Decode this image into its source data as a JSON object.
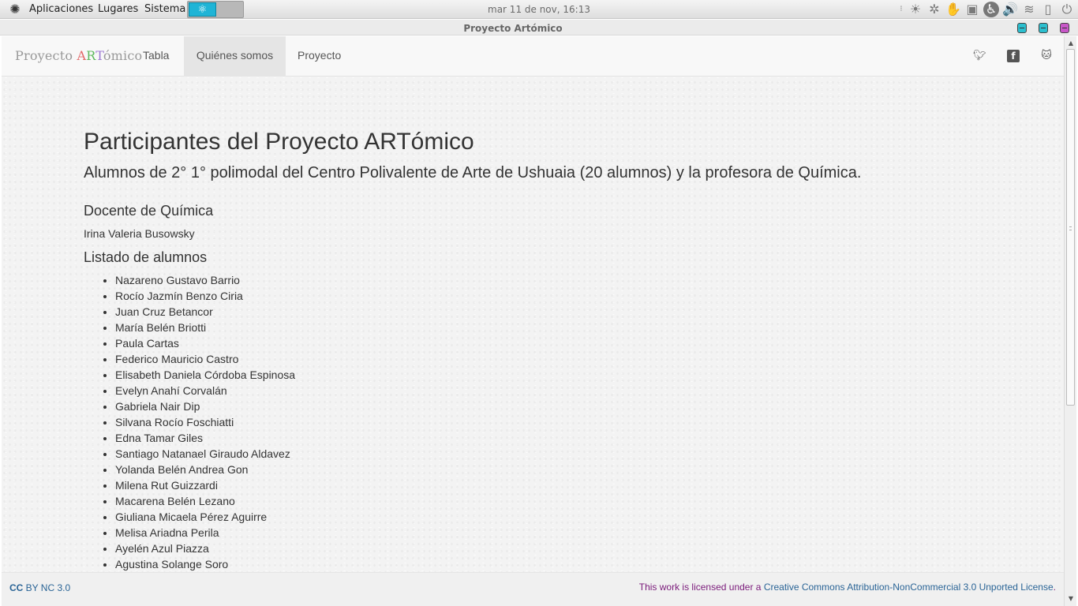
{
  "panel": {
    "menus": [
      "Aplicaciones",
      "Lugares",
      "Sistema"
    ],
    "clock": "mar 11 de nov, 16:13",
    "tray_icons": [
      "brightness-icon",
      "bluetooth-icon",
      "gesture-icon",
      "display-icon",
      "accessibility-icon",
      "volume-icon",
      "wifi-icon",
      "battery-icon",
      "power-icon"
    ]
  },
  "window": {
    "title": "Proyecto Artómico",
    "button_colors": [
      "#2bbfcf",
      "#2bbfcf",
      "#c857c8"
    ]
  },
  "navbar": {
    "brand": {
      "prefix": "Proyecto ",
      "a1": "A",
      "a2": "R",
      "a3": "T",
      "suffix": "ómico"
    },
    "links": [
      "Tabla",
      "Quiénes somos",
      "Proyecto"
    ],
    "active": "Quiénes somos",
    "social": [
      "twitter-icon",
      "facebook-icon",
      "github-icon"
    ]
  },
  "content": {
    "title": "Participantes del Proyecto ARTómico",
    "subtitle": "Alumnos de 2° 1° polimodal del Centro Polivalente de Arte de Ushuaia (20 alumnos) y la profesora de Química.",
    "teacher_heading": "Docente de Química",
    "teacher": "Irina Valeria Busowsky",
    "students_heading": "Listado de alumnos",
    "students": [
      "Nazareno Gustavo Barrio",
      "Rocío Jazmín Benzo Ciria",
      "Juan Cruz Betancor",
      "María Belén Briotti",
      "Paula Cartas",
      "Federico Mauricio Castro",
      "Elisabeth Daniela Córdoba Espinosa",
      "Evelyn Anahí Corvalán",
      "Gabriela Nair Dip",
      "Silvana Rocío Foschiatti",
      "Edna Tamar Giles",
      "Santiago Natanael Giraudo Aldavez",
      "Yolanda Belén Andrea Gon",
      "Milena Rut Guizzardi",
      "Macarena Belén Lezano",
      "Giuliana Micaela Pérez Aguirre",
      "Melisa Ariadna Perila",
      "Ayelén Azul Piazza",
      "Agustina Solange Soro"
    ]
  },
  "footer": {
    "cc": "CC",
    "cc_rest": " BY NC 3.0",
    "license_prefix": "This work is licensed under a ",
    "license_link": "Creative Commons Attribution-NonCommercial 3.0 Unported License",
    "license_suffix": "."
  }
}
